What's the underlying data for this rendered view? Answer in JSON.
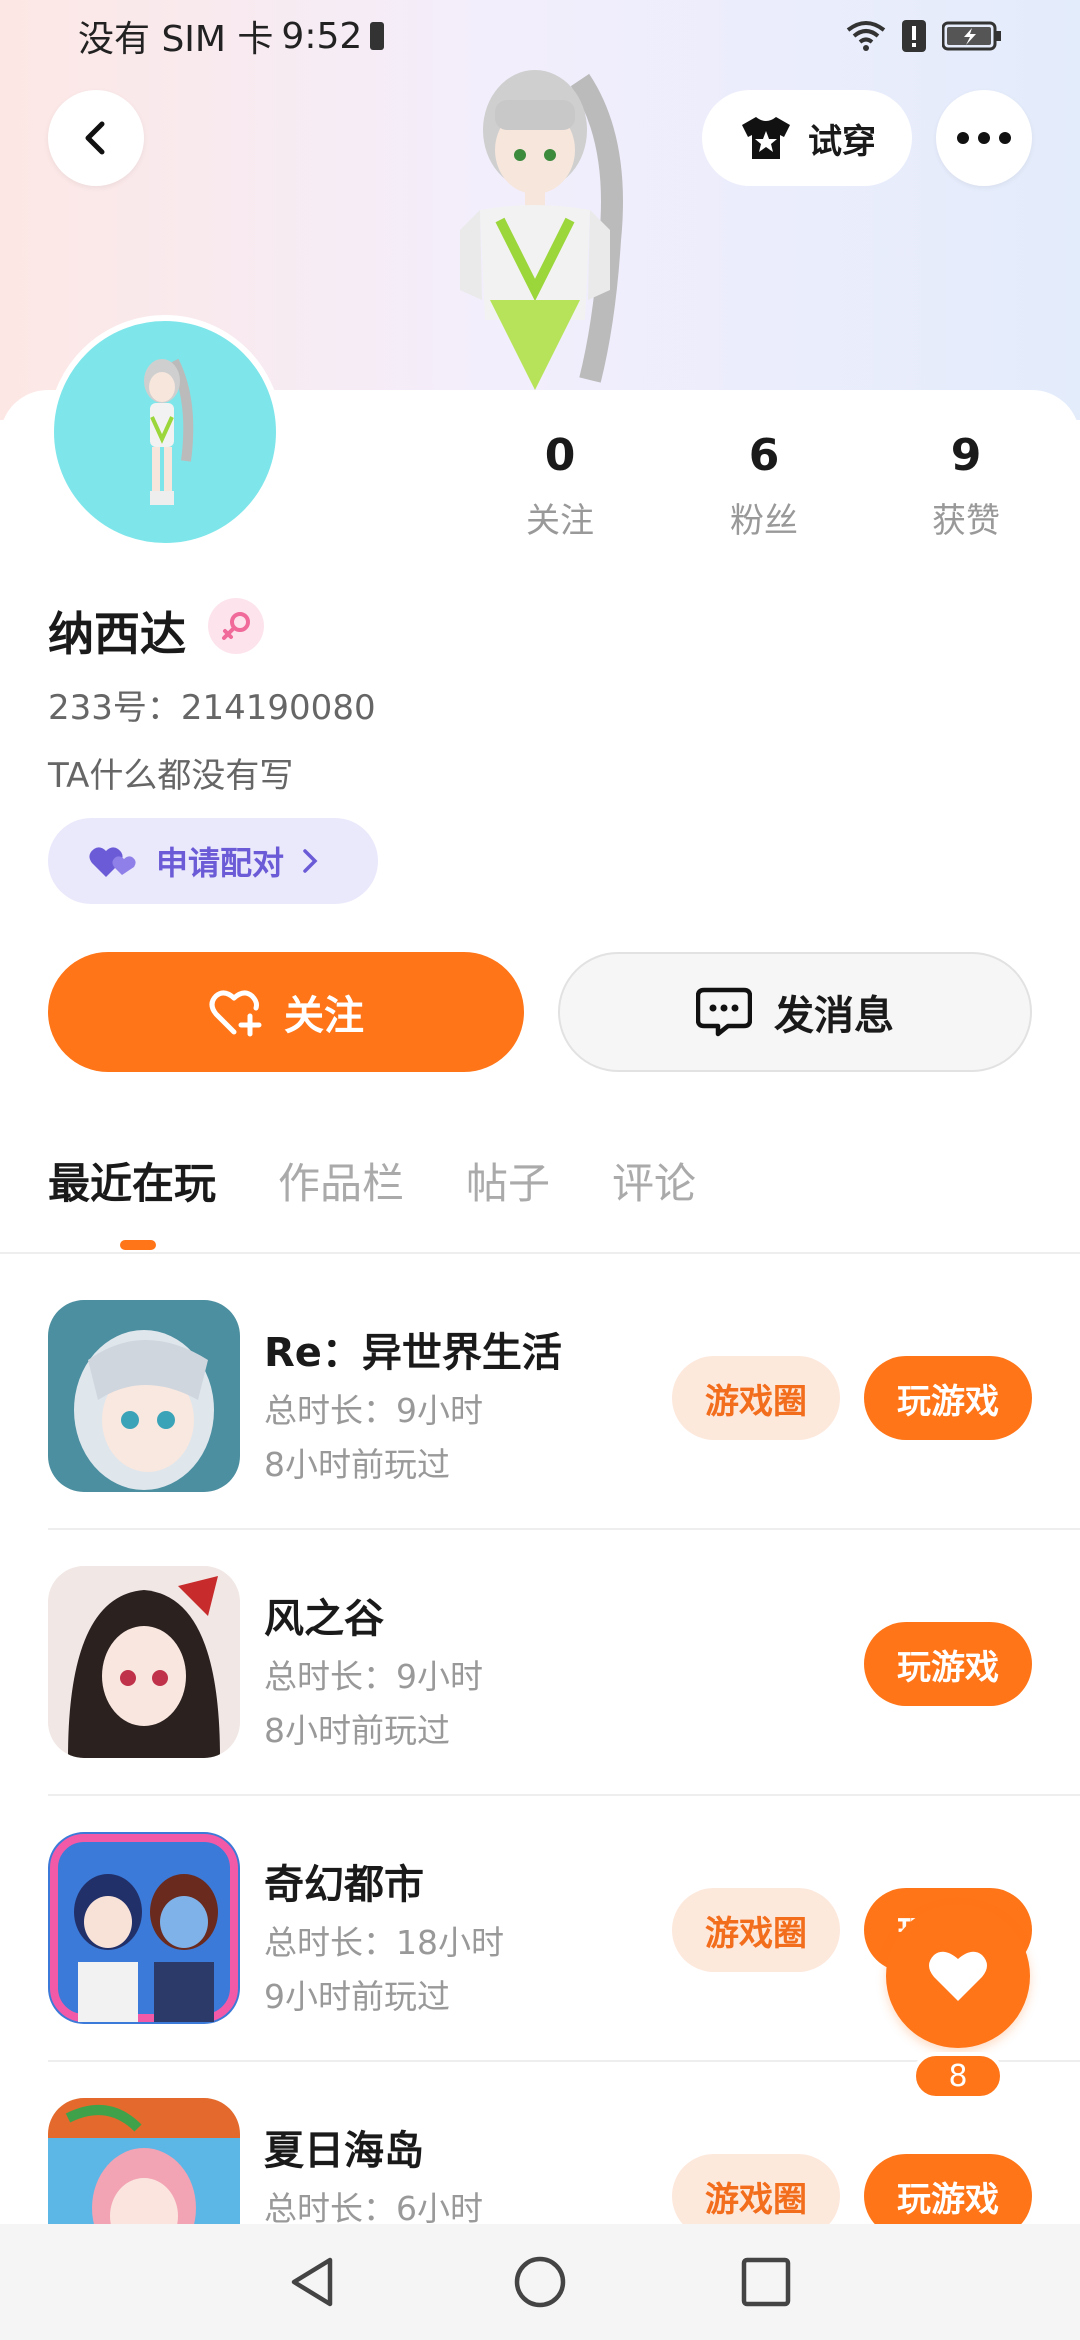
{
  "status_bar": {
    "carrier": "没有 SIM 卡",
    "time": "9:52"
  },
  "header": {
    "tryon_label": "试穿"
  },
  "profile": {
    "name": "纳西达",
    "uid": "233号：214190080",
    "bio": "TA什么都没有写",
    "pair_label": "申请配对",
    "stats": [
      {
        "value": "0",
        "label": "关注"
      },
      {
        "value": "6",
        "label": "粉丝"
      },
      {
        "value": "9",
        "label": "获赞"
      }
    ]
  },
  "actions": {
    "follow_label": "关注",
    "message_label": "发消息"
  },
  "tabs": [
    {
      "label": "最近在玩",
      "active": true
    },
    {
      "label": "作品栏",
      "active": false
    },
    {
      "label": "帖子",
      "active": false
    },
    {
      "label": "评论",
      "active": false
    }
  ],
  "games": [
    {
      "title": "Re：异世界生活",
      "duration": "总时长：9小时",
      "last_played": "8小时前玩过",
      "has_circle": true,
      "circle_label": "游戏圈",
      "play_label": "玩游戏"
    },
    {
      "title": "风之谷",
      "duration": "总时长：9小时",
      "last_played": "8小时前玩过",
      "has_circle": false,
      "circle_label": "",
      "play_label": "玩游戏"
    },
    {
      "title": "奇幻都市",
      "duration": "总时长：18小时",
      "last_played": "9小时前玩过",
      "has_circle": true,
      "circle_label": "游戏圈",
      "play_label": "玩游戏"
    },
    {
      "title": "夏日海岛",
      "duration": "总时长：6小时",
      "last_played": "",
      "has_circle": true,
      "circle_label": "游戏圈",
      "play_label": "玩游戏"
    }
  ],
  "like": {
    "count": "8"
  },
  "colors": {
    "accent": "#ff7518",
    "pair_purple": "#6b5bd6"
  }
}
